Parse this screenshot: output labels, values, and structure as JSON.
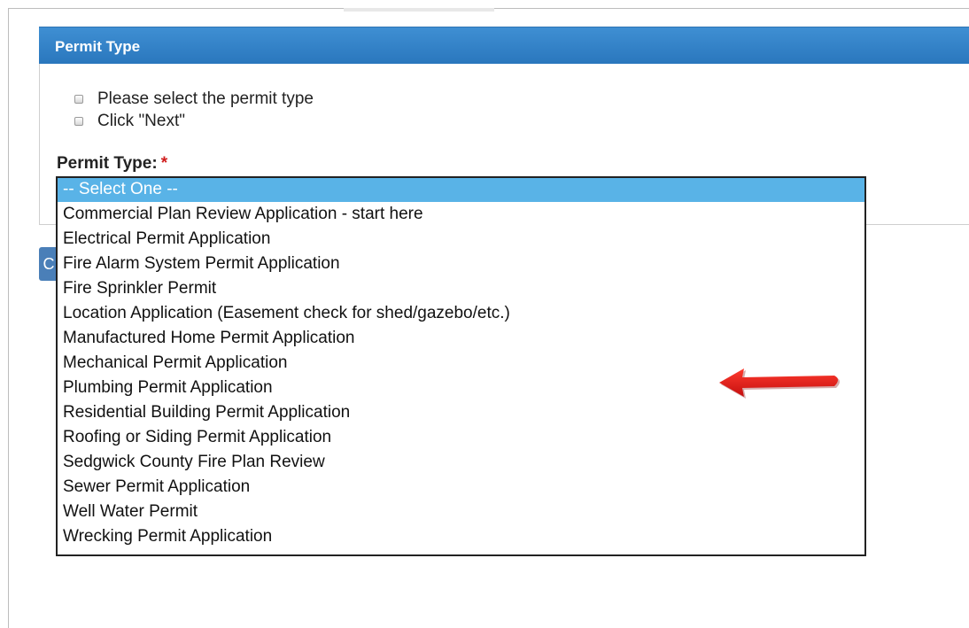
{
  "panel": {
    "title": "Permit Type"
  },
  "instructions": [
    "Please select the permit type",
    "Click \"Next\""
  ],
  "field": {
    "label": "Permit Type:",
    "required_marker": "*"
  },
  "side_button": {
    "label": "C"
  },
  "permit_select": {
    "selected_index": 0,
    "options": [
      "-- Select One --",
      "Commercial Plan Review Application - start here",
      "Electrical Permit Application",
      "Fire Alarm System Permit Application",
      "Fire Sprinkler Permit",
      "Location Application (Easement check for shed/gazebo/etc.)",
      "Manufactured Home Permit Application",
      "Mechanical Permit Application",
      "Plumbing Permit Application",
      "Residential Building Permit Application",
      "Roofing or Siding Permit Application",
      "Sedgwick County Fire Plan Review",
      "Sewer Permit Application",
      "Well Water Permit",
      "Wrecking Permit Application"
    ]
  },
  "annotation": {
    "icon": "red-arrow-icon",
    "color": "#e01818",
    "points_to": "Mechanical Permit Application"
  },
  "colors": {
    "header": "#2f7fc6",
    "selection": "#59b3e7",
    "required": "#d01c1c"
  }
}
